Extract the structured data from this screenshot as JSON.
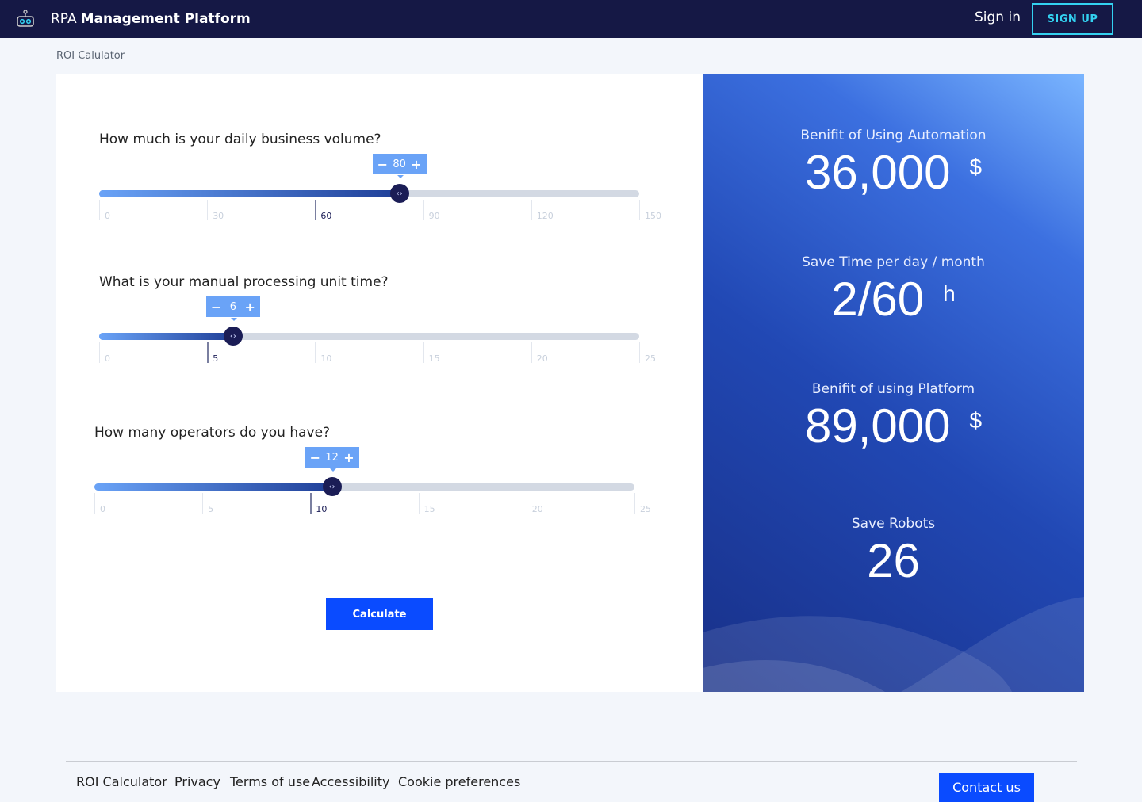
{
  "header": {
    "brand_light": "RPA",
    "brand_bold": "Management Platform",
    "signin": "Sign in",
    "signup": "SIGN UP"
  },
  "breadcrumb": "ROI Calulator",
  "sliders": [
    {
      "question": "How much is your daily business volume?",
      "value": "80",
      "min": 0,
      "max": 150,
      "fraction": 0.556,
      "ticks": [
        "0",
        "30",
        "60",
        "90",
        "120",
        "150"
      ],
      "active_tick": 2
    },
    {
      "question": "What is your manual processing unit time?",
      "value": "6",
      "min": 0,
      "max": 25,
      "fraction": 0.248,
      "ticks": [
        "0",
        "5",
        "10",
        "15",
        "20",
        "25"
      ],
      "active_tick": 1
    },
    {
      "question": "How many operators do you have?",
      "value": "12",
      "min": 0,
      "max": 25,
      "fraction": 0.44,
      "ticks": [
        "0",
        "5",
        "10",
        "15",
        "20",
        "25"
      ],
      "active_tick": 2
    }
  ],
  "calculate_label": "Calculate",
  "results": [
    {
      "label": "Benifit of Using Automation",
      "value": "36,000",
      "unit": "$"
    },
    {
      "label": "Save Time per day / month",
      "value": "2/60",
      "unit": "h"
    },
    {
      "label": "Benifit of using  Platform",
      "value": "89,000",
      "unit": "$"
    },
    {
      "label": "Save Robots",
      "value": "26",
      "unit": ""
    }
  ],
  "footer": {
    "links": [
      "ROI Calculator",
      "Privacy",
      "Terms of use",
      "Accessibility",
      "Cookie preferences"
    ],
    "contact": "Contact us"
  },
  "colors": {
    "header": "#151845",
    "accent": "#0a4bff",
    "signup": "#33d1f0"
  }
}
